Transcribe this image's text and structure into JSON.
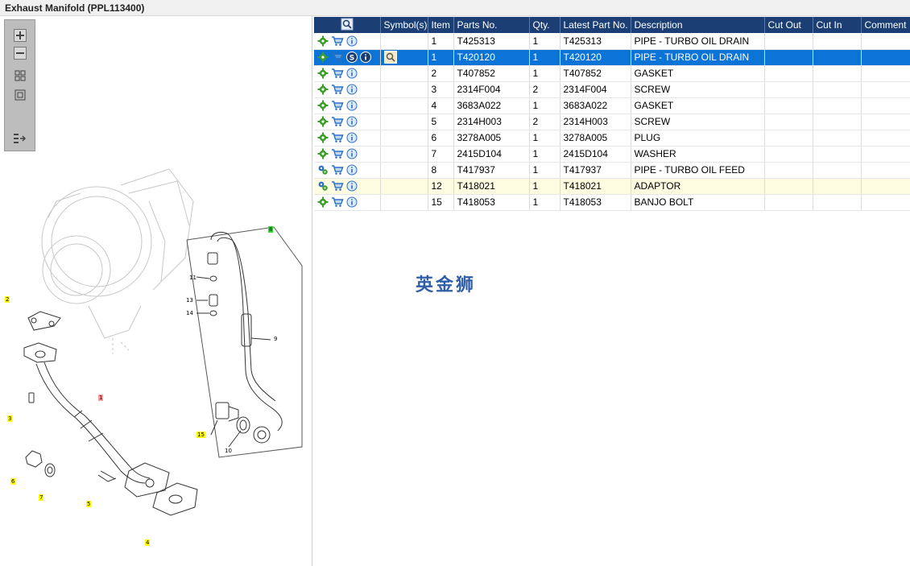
{
  "window": {
    "title": "Exhaust Manifold (PPL113400)"
  },
  "toolbar": {
    "icons": [
      "zoom-in-icon",
      "zoom-out-icon",
      "fit-all-icon",
      "fit-window-icon",
      "export-icon"
    ]
  },
  "diagram": {
    "callouts": [
      {
        "label": "2",
        "style": "y"
      },
      {
        "label": "3",
        "style": "y"
      },
      {
        "label": "6",
        "style": "y"
      },
      {
        "label": "7",
        "style": "y"
      },
      {
        "label": "5",
        "style": "y"
      },
      {
        "label": "4",
        "style": "y"
      },
      {
        "label": "1",
        "style": "r"
      },
      {
        "label": "8",
        "style": "g"
      },
      {
        "label": "15",
        "style": "y"
      },
      {
        "label": "11",
        "style": "n"
      },
      {
        "label": "13",
        "style": "n"
      },
      {
        "label": "14",
        "style": "n"
      },
      {
        "label": "9",
        "style": "n"
      },
      {
        "label": "10",
        "style": "n"
      }
    ]
  },
  "table": {
    "headers": {
      "symbols": "Symbol(s)",
      "item": "Item",
      "parts_no": "Parts No.",
      "qty": "Qty.",
      "latest_part_no": "Latest Part No.",
      "description": "Description",
      "cut_out": "Cut Out",
      "cut_in": "Cut In",
      "comment": "Comment"
    },
    "rows": [
      {
        "item": "1",
        "parts_no": "T425313",
        "qty": "1",
        "latest": "T425313",
        "description": "PIPE - TURBO OIL DRAIN",
        "status": "normal",
        "gear": "single",
        "extra": false
      },
      {
        "item": "1",
        "parts_no": "T420120",
        "qty": "1",
        "latest": "T420120",
        "description": "PIPE - TURBO OIL DRAIN",
        "status": "selected",
        "gear": "single",
        "extra": true
      },
      {
        "item": "2",
        "parts_no": "T407852",
        "qty": "1",
        "latest": "T407852",
        "description": "GASKET",
        "status": "normal",
        "gear": "single",
        "extra": false
      },
      {
        "item": "3",
        "parts_no": "2314F004",
        "qty": "2",
        "latest": "2314F004",
        "description": "SCREW",
        "status": "normal",
        "gear": "single",
        "extra": false
      },
      {
        "item": "4",
        "parts_no": "3683A022",
        "qty": "1",
        "latest": "3683A022",
        "description": "GASKET",
        "status": "normal",
        "gear": "single",
        "extra": false
      },
      {
        "item": "5",
        "parts_no": "2314H003",
        "qty": "2",
        "latest": "2314H003",
        "description": "SCREW",
        "status": "normal",
        "gear": "single",
        "extra": false
      },
      {
        "item": "6",
        "parts_no": "3278A005",
        "qty": "1",
        "latest": "3278A005",
        "description": "PLUG",
        "status": "normal",
        "gear": "single",
        "extra": false
      },
      {
        "item": "7",
        "parts_no": "2415D104",
        "qty": "1",
        "latest": "2415D104",
        "description": "WASHER",
        "status": "normal",
        "gear": "single",
        "extra": false
      },
      {
        "item": "8",
        "parts_no": "T417937",
        "qty": "1",
        "latest": "T417937",
        "description": "PIPE - TURBO OIL FEED",
        "status": "normal",
        "gear": "multi",
        "extra": false
      },
      {
        "item": "12",
        "parts_no": "T418021",
        "qty": "1",
        "latest": "T418021",
        "description": "ADAPTOR",
        "status": "highlight",
        "gear": "multi",
        "extra": false
      },
      {
        "item": "15",
        "parts_no": "T418053",
        "qty": "1",
        "latest": "T418053",
        "description": "BANJO BOLT",
        "status": "normal",
        "gear": "single",
        "extra": false
      }
    ]
  },
  "watermark": "英金狮",
  "colors": {
    "header_bg": "#1b3f74",
    "selected_row": "#0b74d6",
    "highlight_row": "#fdfce0",
    "gear": "#3a9e2a",
    "cart": "#2c6fbf",
    "info": "#2c6fbf"
  }
}
